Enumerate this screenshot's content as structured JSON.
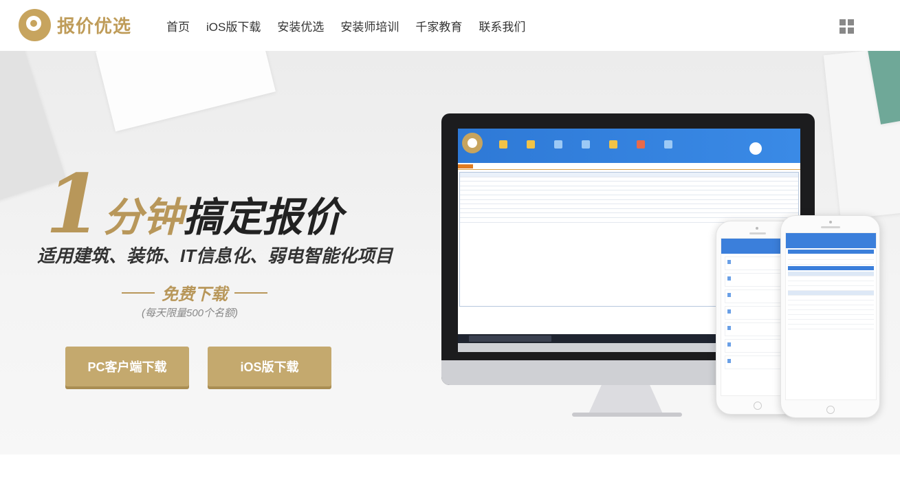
{
  "header": {
    "logo_text": "报价优选",
    "nav": [
      "首页",
      "iOS版下载",
      "安装优选",
      "安装师培训",
      "千家教育",
      "联系我们"
    ],
    "menu_icon": "grid-icon"
  },
  "hero": {
    "headline_number": "1",
    "headline_gold": "分钟",
    "headline_dark": "搞定报价",
    "subline": "适用建筑、装饰、IT信息化、弱电智能化项目",
    "free_text": "免费下载",
    "limit_text": "(每天限量500个名额)",
    "buttons": {
      "pc": "PC客户端下载",
      "ios": "iOS版下载"
    }
  },
  "colors": {
    "gold": "#b8975a",
    "button": "#c4a96e",
    "app_blue": "#3a8ae6"
  }
}
